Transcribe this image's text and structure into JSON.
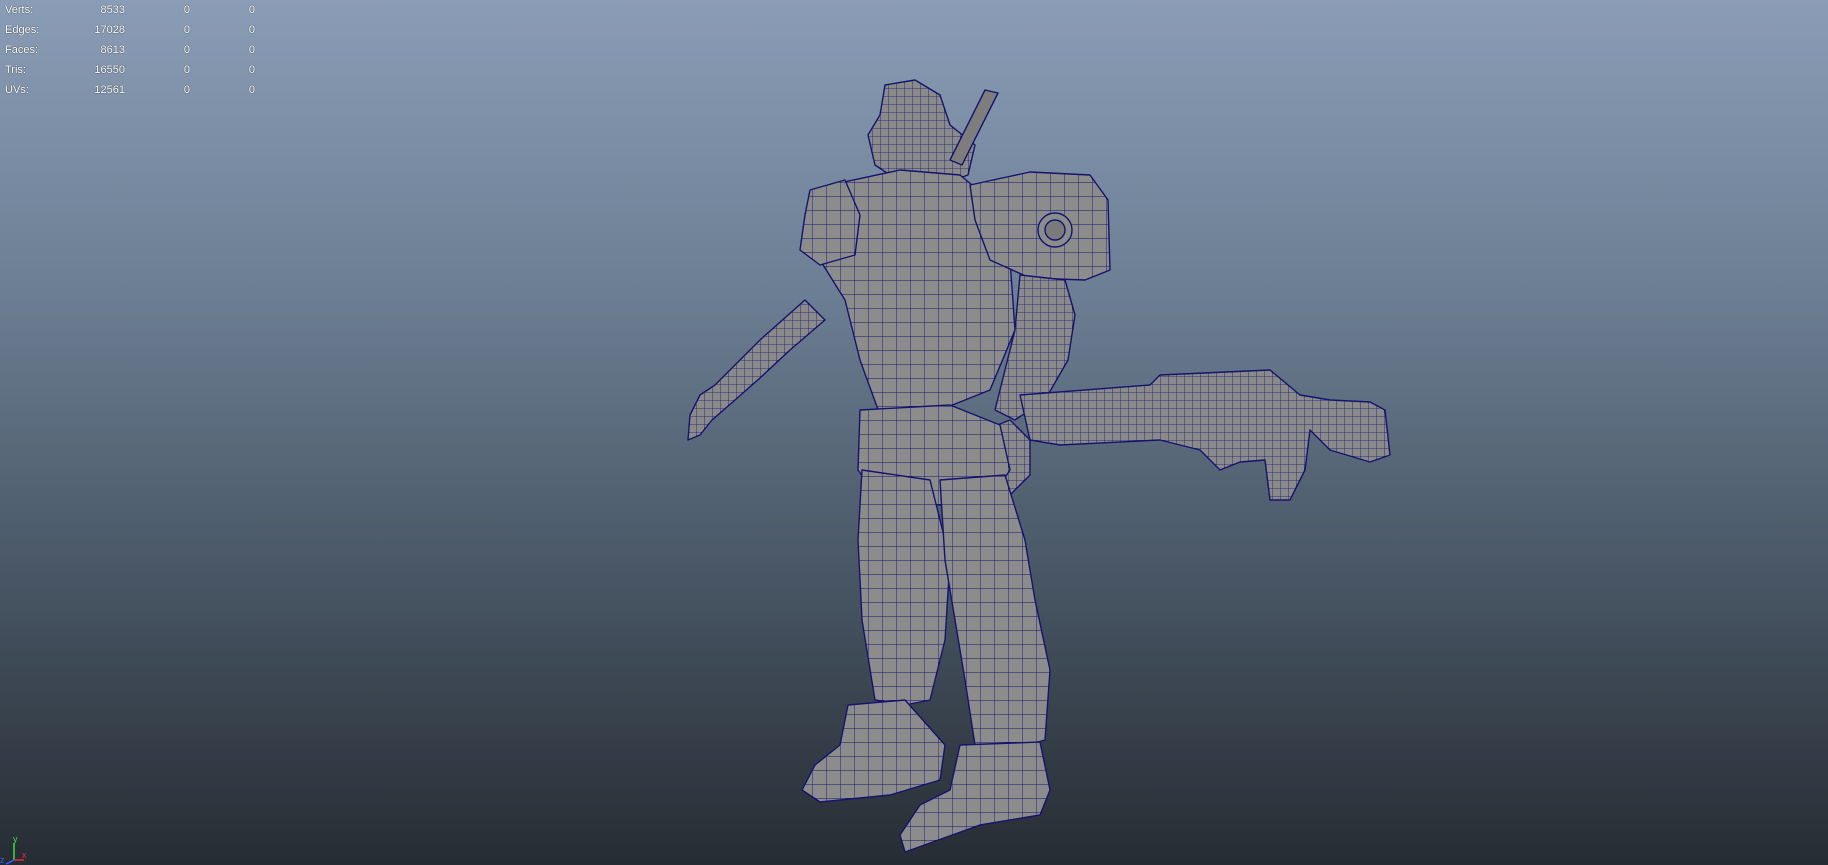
{
  "hud": {
    "rows": [
      {
        "label": "Verts:",
        "total": "8533",
        "selected": "0",
        "uv": "0"
      },
      {
        "label": "Edges:",
        "total": "17028",
        "selected": "0",
        "uv": "0"
      },
      {
        "label": "Faces:",
        "total": "8613",
        "selected": "0",
        "uv": "0"
      },
      {
        "label": "Tris:",
        "total": "16550",
        "selected": "0",
        "uv": "0"
      },
      {
        "label": "UVs:",
        "total": "12561",
        "selected": "0",
        "uv": "0"
      }
    ]
  },
  "axis": {
    "y_label": "y",
    "x_label": "x",
    "z_label": "z",
    "y_color": "#3fdc3f",
    "x_color": "#e03030",
    "z_color": "#3060ff"
  },
  "model": {
    "fill_color": "#8c8c8c",
    "wire_color": "#14146e",
    "icon": "wireframe-robot-soldier"
  }
}
